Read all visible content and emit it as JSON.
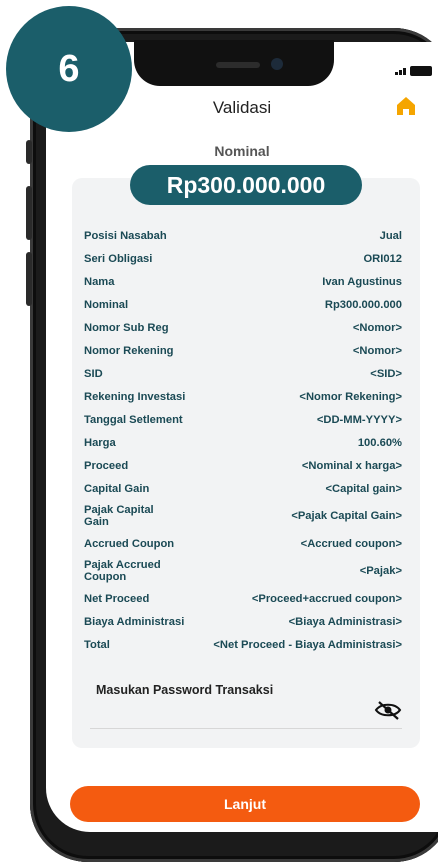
{
  "step_badge": "6",
  "header": {
    "title": "Validasi"
  },
  "nominal": {
    "label": "Nominal",
    "amount": "Rp300.000.000"
  },
  "details": [
    {
      "key": "Posisi Nasabah",
      "value": "Jual"
    },
    {
      "key": "Seri Obligasi",
      "value": "ORI012"
    },
    {
      "key": "Nama",
      "value": "Ivan Agustinus"
    },
    {
      "key": "Nominal",
      "value": "Rp300.000.000"
    },
    {
      "key": "Nomor Sub Reg",
      "value": "<Nomor>"
    },
    {
      "key": "Nomor Rekening",
      "value": "<Nomor>"
    },
    {
      "key": "SID",
      "value": "<SID>"
    },
    {
      "key": "Rekening Investasi",
      "value": "<Nomor Rekening>"
    },
    {
      "key": "Tanggal Setlement",
      "value": "<DD-MM-YYYY>"
    },
    {
      "key": "Harga",
      "value": "100.60%"
    },
    {
      "key": "Proceed",
      "value": "<Nominal x harga>"
    },
    {
      "key": "Capital Gain",
      "value": "<Capital gain>"
    },
    {
      "key": "Pajak Capital Gain",
      "value": "<Pajak Capital Gain>"
    },
    {
      "key": "Accrued Coupon",
      "value": "<Accrued coupon>"
    },
    {
      "key": "Pajak Accrued Coupon",
      "value": "<Pajak>"
    },
    {
      "key": "Net Proceed",
      "value": "<Proceed+accrued coupon>"
    },
    {
      "key": "Biaya Administrasi",
      "value": "<Biaya Administrasi>"
    },
    {
      "key": "Total",
      "value": "<Net Proceed - Biaya Administrasi>"
    }
  ],
  "password": {
    "label": "Masukan Password Transaksi",
    "toggle_icon": "eye-off-icon"
  },
  "cta": {
    "label": "Lanjut"
  },
  "colors": {
    "brand": "#1b5e6a",
    "accent": "#f45b10",
    "home_icon": "#f5a500"
  }
}
